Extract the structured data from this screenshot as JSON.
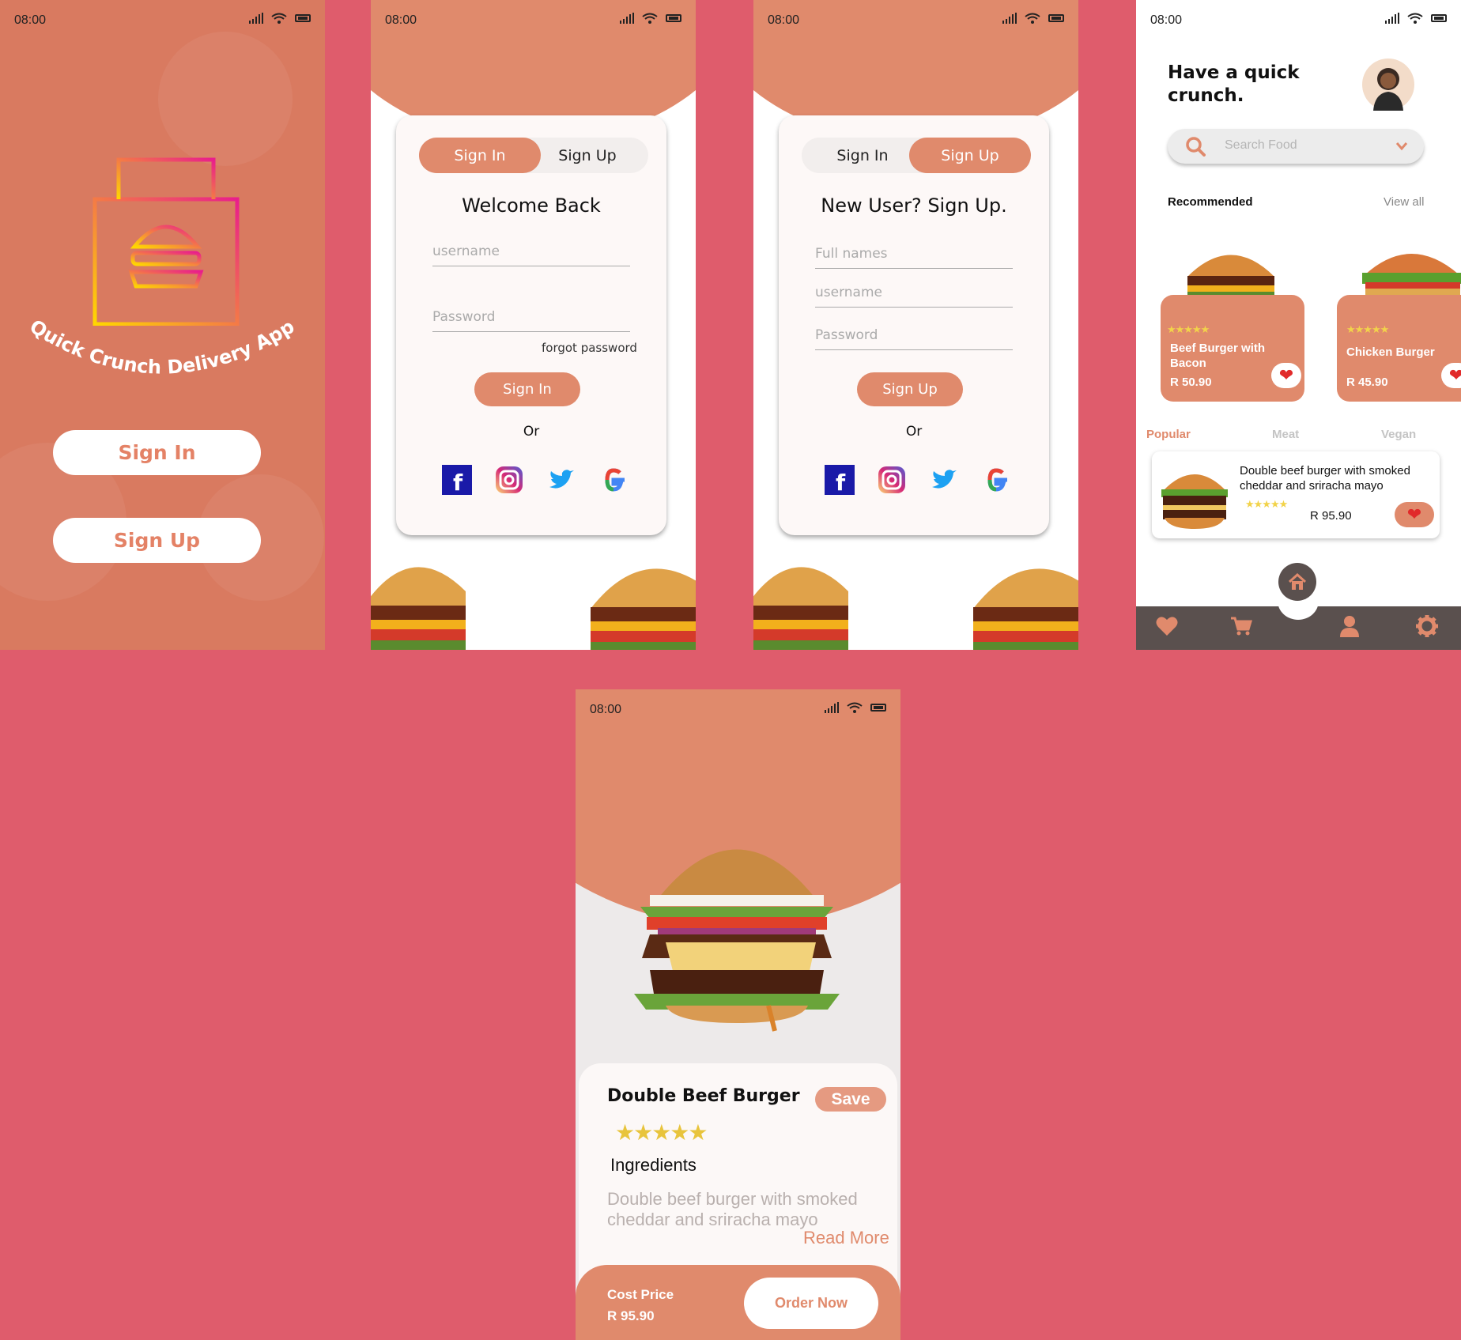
{
  "status_time": "08:00",
  "screen1": {
    "app_name": "Quick Crunch Delivery App",
    "signin_label": "Sign In",
    "signup_label": "Sign Up"
  },
  "screen2": {
    "tab_signin": "Sign In",
    "tab_signup": "Sign Up",
    "heading": "Welcome Back",
    "username_placeholder": "username",
    "password_placeholder": "Password",
    "forgot": "forgot password",
    "action": "Sign In",
    "or": "Or"
  },
  "screen3": {
    "tab_signin": "Sign In",
    "tab_signup": "Sign Up",
    "heading": "New User? Sign Up.",
    "fullnames_placeholder": "Full names",
    "username_placeholder": "username",
    "password_placeholder": "Password",
    "action": "Sign Up",
    "or": "Or"
  },
  "screen4": {
    "greeting_line1": "Have a quick",
    "greeting_line2": "crunch.",
    "search_placeholder": "Search Food",
    "recommended": "Recommended",
    "view_all": "View all",
    "foods": [
      {
        "name_line1": "Beef Burger with",
        "name_line2": "Bacon",
        "price": "R 50.90",
        "rating": 5
      },
      {
        "name_line1": "Chicken Burger",
        "name_line2": "",
        "price": "R 45.90",
        "rating": 5
      }
    ],
    "categories": [
      "Popular",
      "Meat",
      "Vegan"
    ],
    "active_category": "Popular",
    "popular_item": {
      "desc_line1": "Double beef burger with smoked",
      "desc_line2": "cheddar and sriracha mayo",
      "price": "R 95.90",
      "rating": 5
    },
    "nav_icons": [
      "heart-icon",
      "cart-icon",
      "home-icon",
      "user-icon",
      "gear-icon"
    ]
  },
  "screen5": {
    "title": "Double Beef Burger",
    "save": "Save",
    "rating": 5,
    "ingredients_label": "Ingredients",
    "desc_line1": "Double beef burger with smoked",
    "desc_line2": "cheddar and sriracha mayo",
    "read_more": "Read More",
    "cost_label": "Cost Price",
    "cost_value": "R 95.90",
    "order": "Order Now"
  },
  "colors": {
    "background": "#df5c6c",
    "accent": "#e08a6c",
    "star": "#e8c43c",
    "nav": "#5a504e"
  }
}
